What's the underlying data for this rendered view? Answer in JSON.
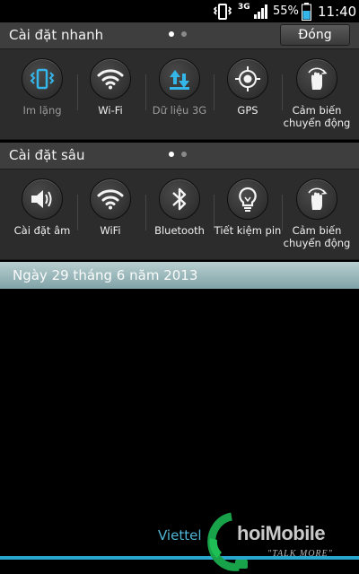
{
  "status_bar": {
    "network_type": "3G",
    "battery_percent": "55%",
    "time": "11:40"
  },
  "quick_settings": {
    "title": "Cài đặt nhanh",
    "close_label": "Đóng",
    "tiles": [
      {
        "label": "Im lặng",
        "icon": "vibrate-icon",
        "active": false
      },
      {
        "label": "Wi-Fi",
        "icon": "wifi-icon",
        "active": true
      },
      {
        "label": "Dữ liệu 3G",
        "icon": "data-transfer-icon",
        "active": false
      },
      {
        "label": "GPS",
        "icon": "gps-icon",
        "active": true
      },
      {
        "label": "Cảm biến chuyển động",
        "icon": "gesture-hand-icon",
        "active": true
      }
    ]
  },
  "advanced_settings": {
    "title": "Cài đặt sâu",
    "tiles": [
      {
        "label": "Cài đặt âm",
        "icon": "speaker-icon"
      },
      {
        "label": "WiFi",
        "icon": "wifi-icon"
      },
      {
        "label": "Bluetooth",
        "icon": "bluetooth-icon"
      },
      {
        "label": "Tiết kiệm pin",
        "icon": "lightbulb-icon"
      },
      {
        "label": "Cảm biến chuyển động",
        "icon": "gesture-hand-icon"
      }
    ]
  },
  "date_bar": {
    "text": "Ngày 29 tháng 6 năm 2013"
  },
  "carrier": "Viettel",
  "watermark": {
    "brand": "hoiMobile",
    "tagline": "\"TALK MORE\""
  },
  "colors": {
    "accent_blue": "#2aa7cf",
    "icon_active_white": "#f4f4f4",
    "icon_blue": "#35b6e9",
    "date_bar": "#9fbfc2"
  }
}
